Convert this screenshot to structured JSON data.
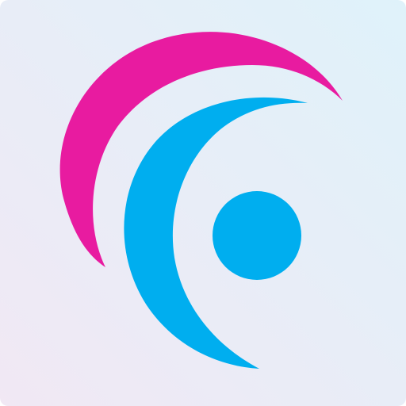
{
  "app_icon": {
    "icon_name": "app-logo-icon",
    "colors": {
      "background_start": "#f1e8f4",
      "background_end": "#dff2fa",
      "outer_arc": "#e81ba0",
      "inner_arc": "#00aeef",
      "dot": "#00aeef"
    }
  }
}
